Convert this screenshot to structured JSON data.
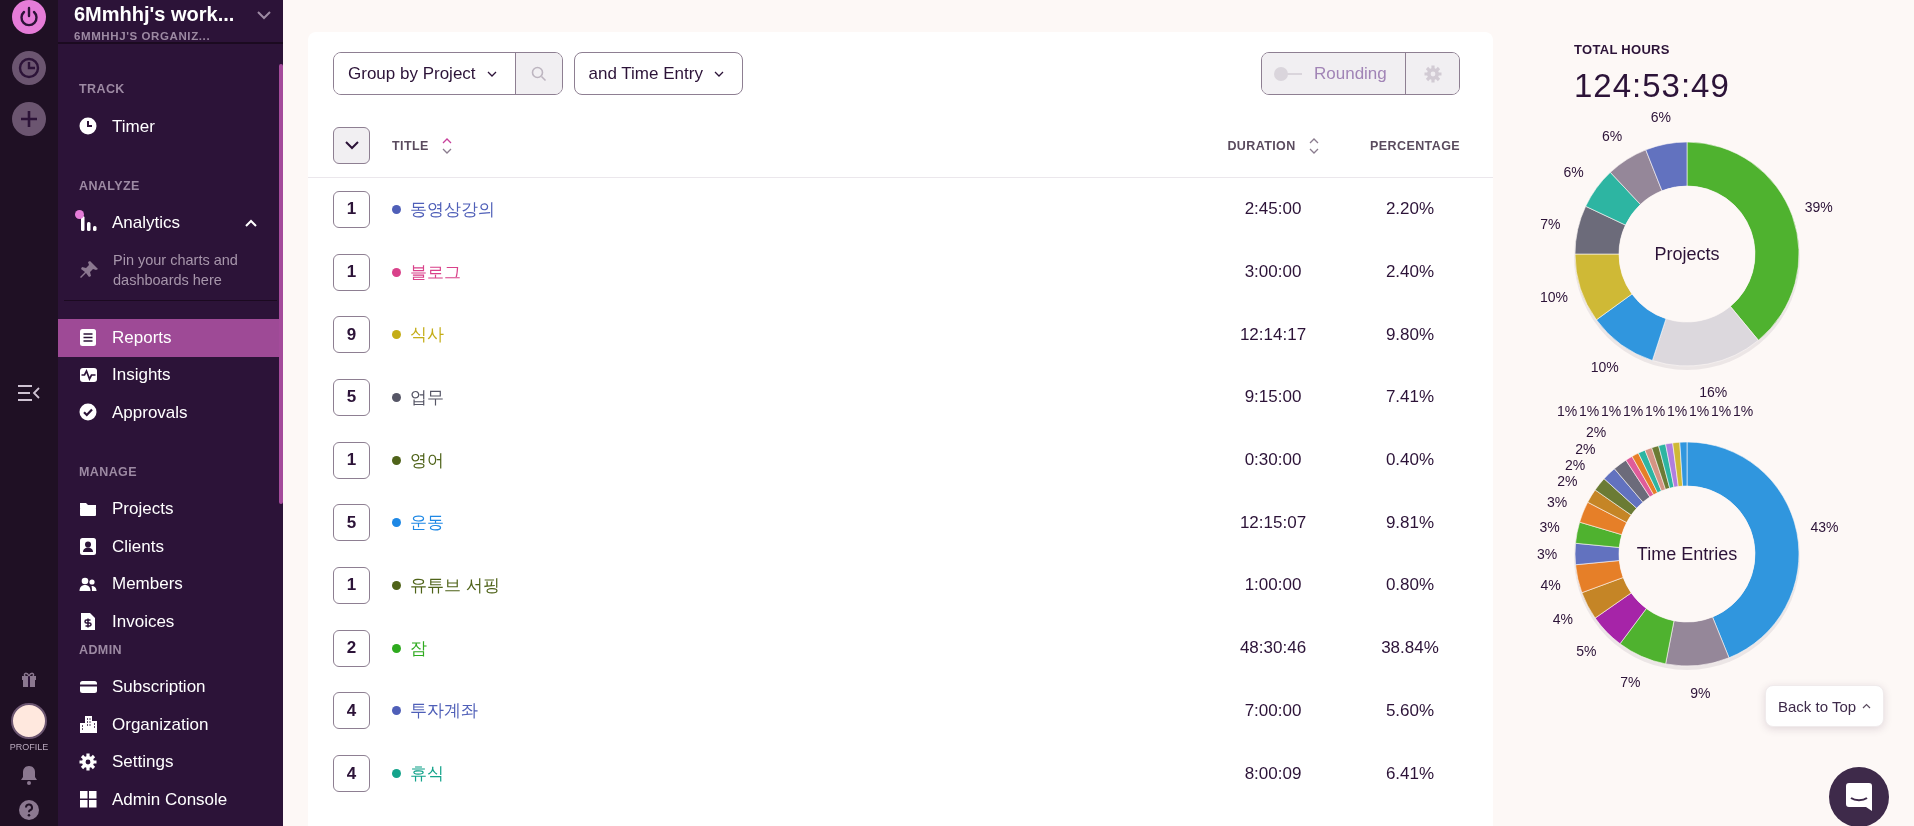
{
  "rail": {
    "profile_label": "PROFILE"
  },
  "sidebar": {
    "workspace": {
      "name": "6Mmhhj's work...",
      "organization": "6MMHHJ'S ORGANIZ..."
    },
    "sections": [
      {
        "heading": "TRACK",
        "items": [
          {
            "label": "Timer",
            "selected": false
          }
        ]
      },
      {
        "heading": "ANALYZE",
        "items": [
          {
            "label": "Analytics",
            "selected": false,
            "expanded": true,
            "notification": true,
            "hint": "Pin your charts and dashboards here"
          },
          {
            "label": "Reports",
            "selected": true
          },
          {
            "label": "Insights",
            "selected": false
          },
          {
            "label": "Approvals",
            "selected": false
          }
        ]
      },
      {
        "heading": "MANAGE",
        "items": [
          {
            "label": "Projects",
            "selected": false
          },
          {
            "label": "Clients",
            "selected": false
          },
          {
            "label": "Members",
            "selected": false
          },
          {
            "label": "Invoices",
            "selected": false
          }
        ]
      },
      {
        "heading": "ADMIN",
        "items": [
          {
            "label": "Subscription",
            "selected": false
          },
          {
            "label": "Organization",
            "selected": false
          },
          {
            "label": "Settings",
            "selected": false
          },
          {
            "label": "Admin Console",
            "selected": false
          }
        ]
      }
    ]
  },
  "toolbar": {
    "group_by": "Group by Project",
    "sub_group": "and Time Entry",
    "rounding": {
      "label": "Rounding",
      "on": false,
      "disabled": true
    }
  },
  "table": {
    "columns": [
      {
        "label": "TITLE",
        "sortable": true
      },
      {
        "label": "DURATION",
        "sortable": true
      },
      {
        "label": "PERCENTAGE",
        "sortable": false
      }
    ],
    "rows": [
      {
        "count": "1",
        "title": "동영상강의",
        "color": "#4f5fb8",
        "duration": "2:45:00",
        "percentage": "2.20%"
      },
      {
        "count": "1",
        "title": "블로그",
        "color": "#d9418a",
        "duration": "3:00:00",
        "percentage": "2.40%"
      },
      {
        "count": "9",
        "title": "식사",
        "color": "#c4ad17",
        "duration": "12:14:17",
        "percentage": "9.80%"
      },
      {
        "count": "5",
        "title": "업무",
        "color": "#565666",
        "duration": "9:15:00",
        "percentage": "7.41%"
      },
      {
        "count": "1",
        "title": "영어",
        "color": "#4f6319",
        "duration": "0:30:00",
        "percentage": "0.40%"
      },
      {
        "count": "5",
        "title": "운동",
        "color": "#1e88e5",
        "duration": "12:15:07",
        "percentage": "9.81%"
      },
      {
        "count": "1",
        "title": "유튜브 서핑",
        "color": "#4f6319",
        "duration": "1:00:00",
        "percentage": "0.80%"
      },
      {
        "count": "2",
        "title": "잠",
        "color": "#2eaa1e",
        "duration": "48:30:46",
        "percentage": "38.84%"
      },
      {
        "count": "4",
        "title": "투자계좌",
        "color": "#4f5fb8",
        "duration": "7:00:00",
        "percentage": "5.60%"
      },
      {
        "count": "4",
        "title": "휴식",
        "color": "#14a38b",
        "duration": "8:00:09",
        "percentage": "6.41%"
      }
    ]
  },
  "summary": {
    "total_label": "TOTAL HOURS",
    "total": "124:53:49",
    "charts": [
      {
        "chart_data": {
          "type": "donut",
          "title": "Projects",
          "value_labels": [
            "39%",
            "16%",
            "10%",
            "10%",
            "7%",
            "6%",
            "6%",
            "6%"
          ],
          "series": [
            {
              "values": [
                39,
                16,
                10,
                10,
                7,
                6,
                6,
                6
              ]
            }
          ],
          "colors": [
            "#4fb22f",
            "#dcd8dd",
            "#3096de",
            "#cfb936",
            "#6c6b7a",
            "#2db5a2",
            "#958799",
            "#6272bf"
          ]
        }
      },
      {
        "chart_data": {
          "type": "donut",
          "title": "Time Entries",
          "value_labels": [
            "43%",
            "9%",
            "7%",
            "5%",
            "4%",
            "4%",
            "3%",
            "3%",
            "3%",
            "2%",
            "2%",
            "2%",
            "2%",
            "1%",
            "1%",
            "1%",
            "1%",
            "1%",
            "1%",
            "1%",
            "1%",
            "1%"
          ],
          "series": [
            {
              "values": [
                43,
                9,
                7,
                5,
                4,
                4,
                3,
                3,
                3,
                2,
                2,
                2,
                2,
                1,
                1,
                1,
                1,
                1,
                1,
                1,
                1,
                1
              ]
            }
          ],
          "colors": [
            "#3096de",
            "#958799",
            "#4fb22f",
            "#a624a8",
            "#c58526",
            "#e67f28",
            "#6272bf",
            "#4fb22f",
            "#e67f28",
            "#c58526",
            "#6b7b34",
            "#6272bf",
            "#6c6b7a",
            "#df5c9a",
            "#e67f28",
            "#2db5a2",
            "#d59484",
            "#6b7b34",
            "#2db5a2",
            "#b07ee0",
            "#cfb936",
            "#3096de"
          ]
        }
      }
    ]
  },
  "back_to_top": "Back to Top"
}
